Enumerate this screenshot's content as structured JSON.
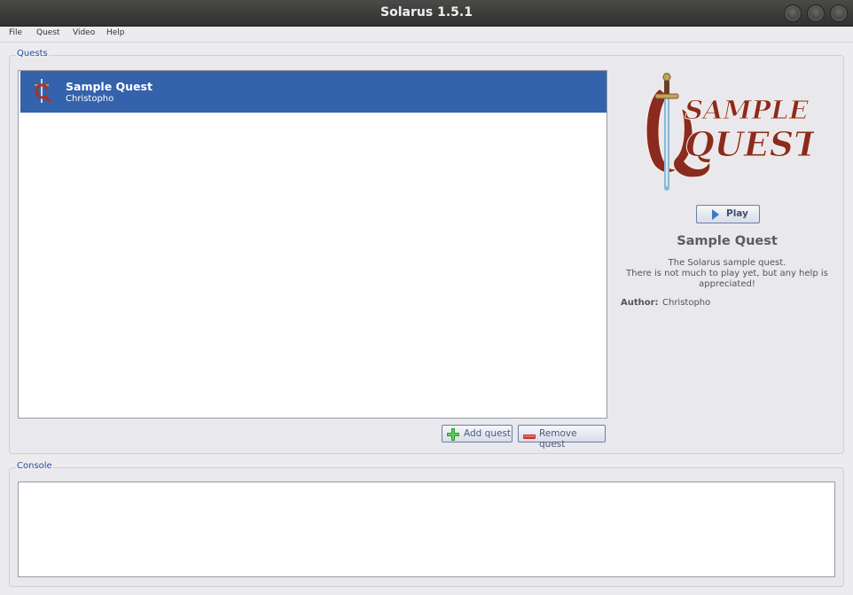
{
  "window": {
    "title": "Solarus 1.5.1"
  },
  "menu": [
    "File",
    "Quest",
    "Video",
    "Help"
  ],
  "quests_panel": {
    "label": "Quests",
    "items": [
      {
        "title": "Sample Quest",
        "author": "Christopho",
        "selected": true
      }
    ],
    "add_button": "Add quest",
    "remove_button": "Remove quest"
  },
  "details": {
    "logo_line1": "SAMPLE",
    "logo_line2": "QUEST",
    "play_button": "Play",
    "title": "Sample Quest",
    "description_lines": [
      "The Solarus sample quest.",
      "There is not much to play yet, but any help is",
      "appreciated!"
    ],
    "author_label": "Author:",
    "author": "Christopho"
  },
  "console": {
    "label": "Console"
  },
  "colors": {
    "selection": "#3462ab",
    "logo_red": "#8b2a1f",
    "group_label": "#2a4fa0"
  },
  "icons": [
    "quest-icon",
    "plus-icon",
    "minus-icon",
    "play-icon",
    "sword-icon"
  ]
}
